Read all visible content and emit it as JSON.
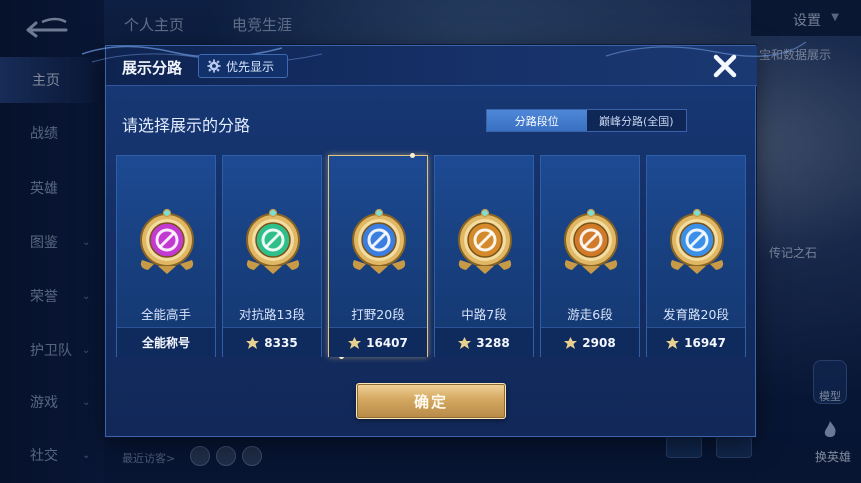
{
  "background": {
    "top_tabs": [
      "个人主页",
      "电竞生涯"
    ],
    "settings_label": "设置",
    "right_texts": [
      "宝和数据展示",
      "传记之石"
    ],
    "side_button_label": "模型",
    "switch_hero_label": "换英雄",
    "recent_visitors_label": "最近访客>",
    "nav": [
      {
        "label": "主页",
        "active": true,
        "has_chevron": false
      },
      {
        "label": "战绩",
        "active": false,
        "has_chevron": false
      },
      {
        "label": "英雄",
        "active": false,
        "has_chevron": false
      },
      {
        "label": "图鉴",
        "active": false,
        "has_chevron": true
      },
      {
        "label": "荣誉",
        "active": false,
        "has_chevron": true
      },
      {
        "label": "护卫队",
        "active": false,
        "has_chevron": true
      },
      {
        "label": "游戏",
        "active": false,
        "has_chevron": true
      },
      {
        "label": "社交",
        "active": false,
        "has_chevron": true
      }
    ]
  },
  "dialog": {
    "title": "展示分路",
    "priority_button": "优先显示",
    "subtitle": "请选择展示的分路",
    "segments": [
      {
        "label": "分路段位",
        "active": true
      },
      {
        "label": "巅峰分路(全国)",
        "active": false
      }
    ],
    "cards": [
      {
        "name": "全能高手",
        "stat": "全能称号",
        "stat_icon": false,
        "selected": false,
        "emblem_icon": "all-round-emblem-icon",
        "color": "#c23ad1"
      },
      {
        "name": "对抗路13段",
        "stat": "8335",
        "stat_icon": true,
        "selected": false,
        "emblem_icon": "clash-lane-emblem-icon",
        "color": "#2fbf8a"
      },
      {
        "name": "打野20段",
        "stat": "16407",
        "stat_icon": true,
        "selected": true,
        "emblem_icon": "jungle-emblem-icon",
        "color": "#3b7ee0"
      },
      {
        "name": "中路7段",
        "stat": "3288",
        "stat_icon": true,
        "selected": false,
        "emblem_icon": "mid-lane-emblem-icon",
        "color": "#d48a2a"
      },
      {
        "name": "游走6段",
        "stat": "2908",
        "stat_icon": true,
        "selected": false,
        "emblem_icon": "roam-emblem-icon",
        "color": "#d07a2a"
      },
      {
        "name": "发育路20段",
        "stat": "16947",
        "stat_icon": true,
        "selected": false,
        "emblem_icon": "farm-lane-emblem-icon",
        "color": "#3a8fe8"
      }
    ],
    "confirm_button": "确定"
  }
}
